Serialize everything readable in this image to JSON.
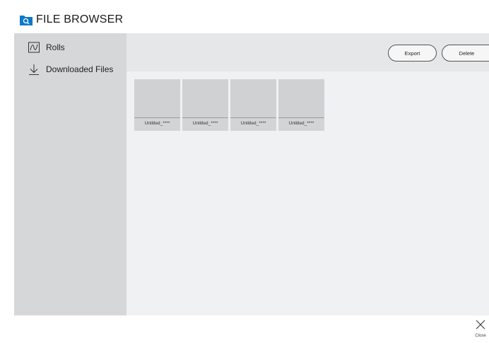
{
  "app": {
    "title": "FILE BROWSER",
    "icon": "folder-search-icon",
    "accent_color": "#0b78c8"
  },
  "sidebar": {
    "items": [
      {
        "label": "Rolls",
        "icon": "roll-icon"
      },
      {
        "label": "Downloaded Files",
        "icon": "download-icon"
      }
    ]
  },
  "toolbar": {
    "export_label": "Export",
    "delete_label": "Delete"
  },
  "files": [
    {
      "name": "Untitled_****"
    },
    {
      "name": "Untitled_****"
    },
    {
      "name": "Untitled_****"
    },
    {
      "name": "Untitled_****"
    }
  ],
  "footer": {
    "close_label": "Close",
    "close_icon": "close-icon"
  }
}
